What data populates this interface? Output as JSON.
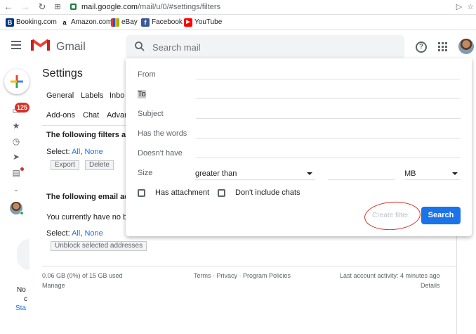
{
  "browser": {
    "url_host": "mail.google.com",
    "url_path": "/mail/u/0/#settings/filters",
    "bookmarks": [
      {
        "label": "Booking.com",
        "icon": "booking-icon",
        "color": "#003580",
        "glyph": "B"
      },
      {
        "label": "Amazon.com",
        "icon": "amazon-icon",
        "color": "#ffffff",
        "glyph": "a"
      },
      {
        "label": "eBay",
        "icon": "ebay-icon",
        "color": "#e53238",
        "glyph": "e"
      },
      {
        "label": "Facebook",
        "icon": "facebook-icon",
        "color": "#3b5998",
        "glyph": "f"
      },
      {
        "label": "YouTube",
        "icon": "youtube-icon",
        "color": "#ff0000",
        "glyph": "▶"
      }
    ]
  },
  "header": {
    "app_name": "Gmail",
    "search_placeholder": "Search mail"
  },
  "rail": {
    "unread_badge": "125",
    "bottom_text_line1": "No",
    "bottom_text_line2": "c",
    "bottom_text_line3": "Sta"
  },
  "settings": {
    "title": "Settings",
    "tabs_row1": [
      "General",
      "Labels",
      "Inbo"
    ],
    "tabs_row2": [
      "Add-ons",
      "Chat",
      "Advan"
    ],
    "filters_heading": "The following filters are a",
    "select_label": "Select:",
    "select_all": "All",
    "select_none": "None",
    "export_button": "Export",
    "delete_button": "Delete",
    "blocked_heading": "The following email addr",
    "blocked_empty": "You currently have no blo",
    "select_label2": "Select:",
    "select_all2": "All",
    "select_none2": "None",
    "unblock_button": "Unblock selected addresses"
  },
  "footer": {
    "storage": "0.06 GB (0%) of 15 GB used",
    "manage": "Manage",
    "terms": "Terms · Privacy · Program Policies",
    "last_activity": "Last account activity: 4 minutes ago",
    "details": "Details"
  },
  "filter": {
    "from_label": "From",
    "to_label": "To",
    "subject_label": "Subject",
    "has_words_label": "Has the words",
    "doesnt_have_label": "Doesn't have",
    "size_label": "Size",
    "size_operator": "greater than",
    "size_unit": "MB",
    "has_attachment_label": "Has attachment",
    "no_chats_label": "Don't include chats",
    "create_filter_label": "Create filter",
    "search_button_label": "Search"
  },
  "colors": {
    "accent": "#1a73e8",
    "annotation": "#d93025"
  }
}
